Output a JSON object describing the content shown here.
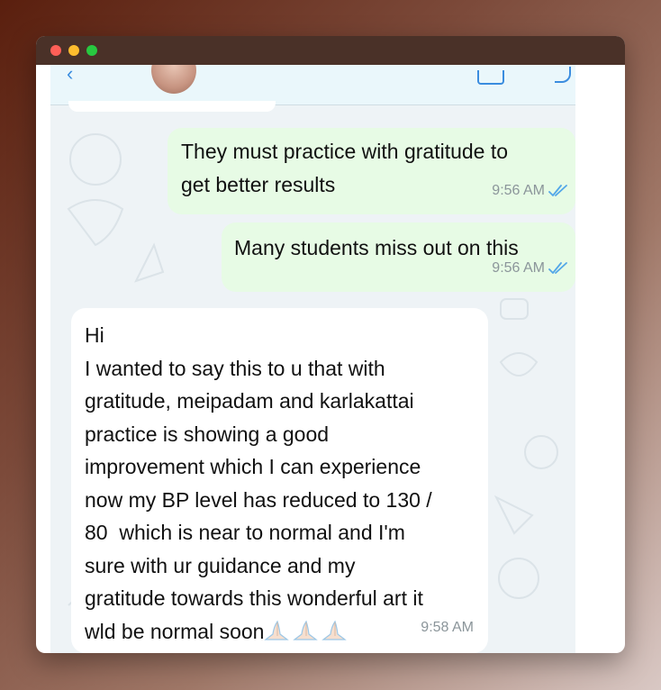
{
  "window": {
    "controls": [
      "close",
      "minimize",
      "zoom"
    ]
  },
  "chat": {
    "header": {
      "title": "",
      "icons": [
        "back-chevron-icon",
        "video-call-icon",
        "phone-call-icon"
      ]
    },
    "messages": [
      {
        "direction": "outgoing",
        "text": "They must practice with gratitude to\nget better results",
        "time": "9:56 AM",
        "status": "read"
      },
      {
        "direction": "outgoing",
        "text": "Many students miss out on this",
        "time": "9:56 AM",
        "status": "read"
      },
      {
        "direction": "incoming",
        "text": "Hi\nI wanted to say this to u that with\ngratitude, meipadam and karlakattai\npractice is showing a good\nimprovement which I can experience\nnow my BP level has reduced to 130 /\n80  which is near to normal and I'm\nsure with ur guidance and my\ngratitude towards this wonderful art it\nwld be normal soon",
        "emojis": [
          "folded-hands-icon",
          "folded-hands-icon",
          "folded-hands-icon"
        ],
        "time": "9:58 AM"
      }
    ],
    "colors": {
      "outgoing_bubble": "#e7fbe5",
      "incoming_bubble": "#ffffff",
      "read_ticks": "#53a7e8",
      "wallpaper": "#eef3f6"
    }
  }
}
